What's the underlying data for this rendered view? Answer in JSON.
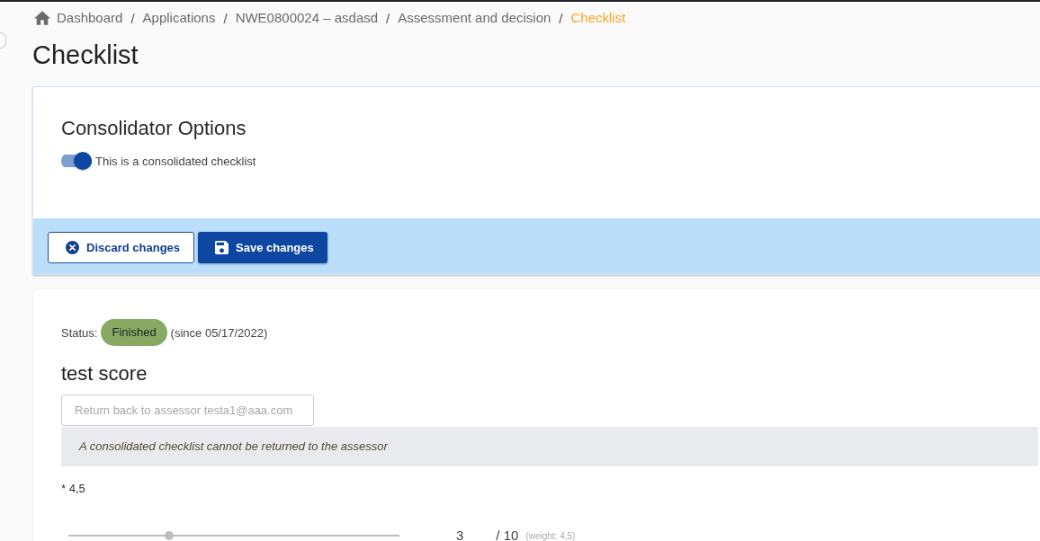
{
  "breadcrumb": [
    {
      "label": "Dashboard",
      "kind": "home",
      "selected": false
    },
    {
      "separator": "/",
      "label": "Applications",
      "kind": "link",
      "selected": false
    },
    {
      "separator": "/",
      "label": "NWE0800024 – asdasd",
      "kind": "link",
      "selected": false
    },
    {
      "separator": "/",
      "label": "Assessment and decision",
      "kind": "link",
      "selected": false
    },
    {
      "separator": "/",
      "label": "Checklist",
      "kind": "link",
      "selected": true
    }
  ],
  "page_title": "Checklist",
  "consolidator_options": {
    "title": "Consolidator Options",
    "toggle": {
      "label": "This is a consolidated checklist",
      "on": true
    }
  },
  "actions": [
    {
      "label": "Discard changes",
      "kind": "discard"
    },
    {
      "label": "Save changes",
      "kind": "save"
    }
  ],
  "checklist": {
    "status_label": "Status:",
    "status": "Finished",
    "status_since": "(since 05/17/2022)",
    "title": "test score",
    "return_field": {
      "placeholder": "Return back to assessor testa1@aaa.com"
    },
    "notice": "A consolidated checklist cannot be returned to the assessor",
    "questions": [
      {
        "label": "* 4,5",
        "disabled": true,
        "level": 0.3,
        "score": "3",
        "max": "/ 10",
        "weight": "(weight: 4,5)"
      }
    ]
  }
}
